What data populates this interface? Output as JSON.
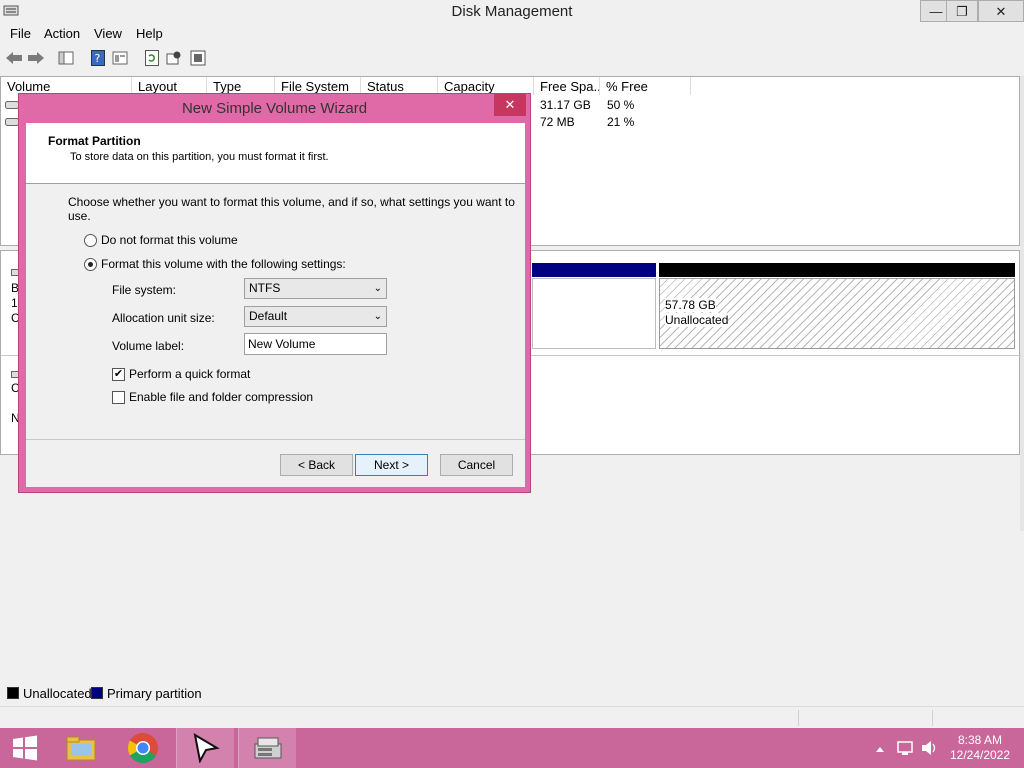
{
  "window": {
    "title": "Disk Management",
    "minimize": "—",
    "maximize": "❐",
    "close": "✕"
  },
  "menu": [
    "File",
    "Action",
    "View",
    "Help"
  ],
  "toolbar_icons": [
    "back-arrow-icon",
    "forward-arrow-icon",
    "console-tree-icon",
    "help-icon",
    "properties-icon",
    "refresh-icon",
    "rescan-icon",
    "settings-icon"
  ],
  "volume_list": {
    "columns": [
      "Volume",
      "Layout",
      "Type",
      "File System",
      "Status",
      "Capacity",
      "Free Spa...",
      "% Free"
    ],
    "rows": [
      {
        "free": "31.17 GB",
        "pct": "50 %"
      },
      {
        "free": "72 MB",
        "pct": "21 %"
      }
    ]
  },
  "disk_view": {
    "left_fragments": [
      "B",
      "1",
      "C",
      "C",
      "N"
    ],
    "unallocated_size": "57.78 GB",
    "unallocated_label": "Unallocated"
  },
  "legend": {
    "unallocated": "Unallocated",
    "primary": "Primary partition",
    "colors": {
      "unallocated": "#000000",
      "primary": "#000080"
    }
  },
  "wizard": {
    "title": "New Simple Volume Wizard",
    "close": "✕",
    "header_title": "Format Partition",
    "header_sub": "To store data on this partition, you must format it first.",
    "instruction": "Choose whether you want to format this volume, and if so, what settings you want to use.",
    "option_no_format": "Do not format this volume",
    "option_format": "Format this volume with the following settings:",
    "file_system_label": "File system:",
    "file_system_value": "NTFS",
    "alloc_label": "Allocation unit size:",
    "alloc_value": "Default",
    "volume_label_label": "Volume label:",
    "volume_label_value": "New Volume",
    "quick_format": "Perform a quick format",
    "quick_format_checked": true,
    "compression": "Enable file and folder compression",
    "compression_checked": false,
    "back": "< Back",
    "next": "Next >",
    "cancel": "Cancel"
  },
  "taskbar": {
    "start": "start-icon",
    "apps": [
      "file-explorer-icon",
      "chrome-icon",
      "cursor-app-icon",
      "disk-management-icon"
    ],
    "time": "8:38 AM",
    "date": "12/24/2022"
  }
}
